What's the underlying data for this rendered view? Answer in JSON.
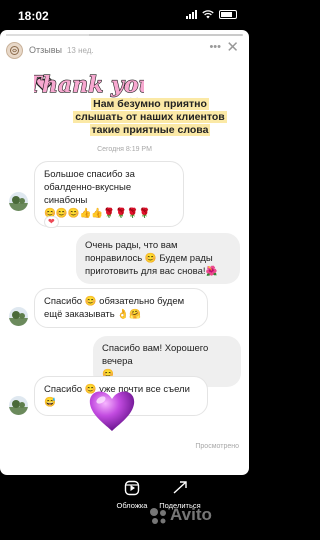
{
  "status_bar": {
    "time": "18:02"
  },
  "story": {
    "progress": 0.35,
    "account_name": "Отзывы",
    "post_age": "13 нед.",
    "more_icon": "ellipsis-icon",
    "close_icon": "close-icon",
    "sticker_text": "Thank you",
    "title_lines": [
      "Нам безумно приятно",
      "слышать от наших клиентов",
      "такие приятные слова"
    ],
    "date_separator": "Сегодня 8:19 PM",
    "messages": [
      {
        "side": "in",
        "lines": [
          "Большое спасибо за",
          "обалденно-вкусные синабоны",
          "😊😊😊👍👍🌹🌹🌹🌹"
        ]
      },
      {
        "side": "out",
        "lines": [
          "Очень рады, что вам",
          "понравилось 😊 Будем рады",
          "приготовить для вас снова!🌺"
        ]
      },
      {
        "side": "in",
        "lines": [
          "Спасибо 😊 обязательно будем",
          "ещё заказывать 👌🤗"
        ]
      },
      {
        "side": "out",
        "lines": [
          "Спасибо вам! Хорошего вечера",
          "😊"
        ]
      },
      {
        "side": "in",
        "lines": [
          "Спасибо 😊 уже почти все съели",
          "😅"
        ]
      }
    ],
    "reaction": "❤",
    "seen_label": "Просмотрено"
  },
  "bottom_bar": {
    "items": [
      {
        "label": "Обложка",
        "icon": "cover-icon"
      },
      {
        "label": "Поделиться",
        "icon": "share-icon"
      }
    ]
  },
  "watermark": {
    "text": "Avito"
  },
  "colors": {
    "title_highlight": "#fbe9a6",
    "sticker_pink": "#f7a8d0",
    "heart_purple": "#b03ad6",
    "bubble_out": "#efefef"
  }
}
